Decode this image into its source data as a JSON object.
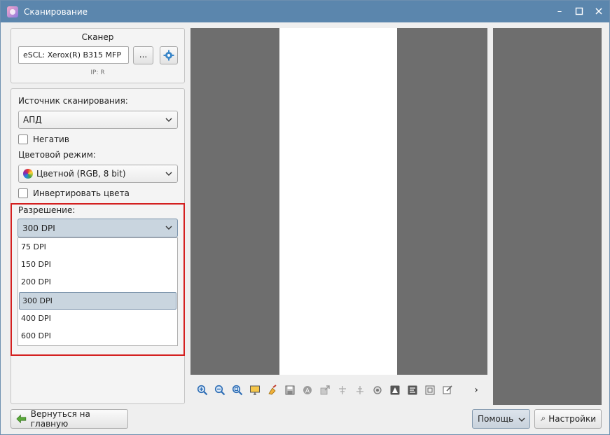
{
  "window": {
    "title": "Сканирование"
  },
  "scanner": {
    "heading": "Сканер",
    "device": "eSCL: Xerox(R) B315 MFP",
    "browse_label": "...",
    "ip_label": "IP: R"
  },
  "settings": {
    "source_label": "Источник сканирования:",
    "source_value": "АПД",
    "negative_label": "Негатив",
    "color_mode_label": "Цветовой режим:",
    "color_mode_value": "Цветной (RGB, 8 bit)",
    "invert_label": "Инвертировать цвета",
    "resolution_label": "Разрешение:",
    "resolution_value": "300 DPI",
    "resolution_options": [
      "75 DPI",
      "150 DPI",
      "200 DPI",
      "300 DPI",
      "400 DPI",
      "600 DPI"
    ],
    "selected_option": "300 DPI"
  },
  "toolbar": {
    "icons": [
      "zoom-in-icon",
      "zoom-out-icon",
      "zoom-fit-icon",
      "monitor-icon",
      "clean-icon",
      "save-icon",
      "text-icon",
      "export-icon",
      "rotate-left-icon",
      "rotate-right-icon",
      "settings-icon",
      "mirror-icon",
      "align-icon",
      "crop-icon",
      "edit-icon"
    ],
    "more_label": "›"
  },
  "footer": {
    "back_label": "Вернуться на главную",
    "help_label": "Помощь",
    "settings_label": "Настройки"
  },
  "colors": {
    "titlebar": "#5b86ad",
    "highlight": "#d42020",
    "selection": "#c9d5df",
    "preview": "#6e6e6e"
  }
}
